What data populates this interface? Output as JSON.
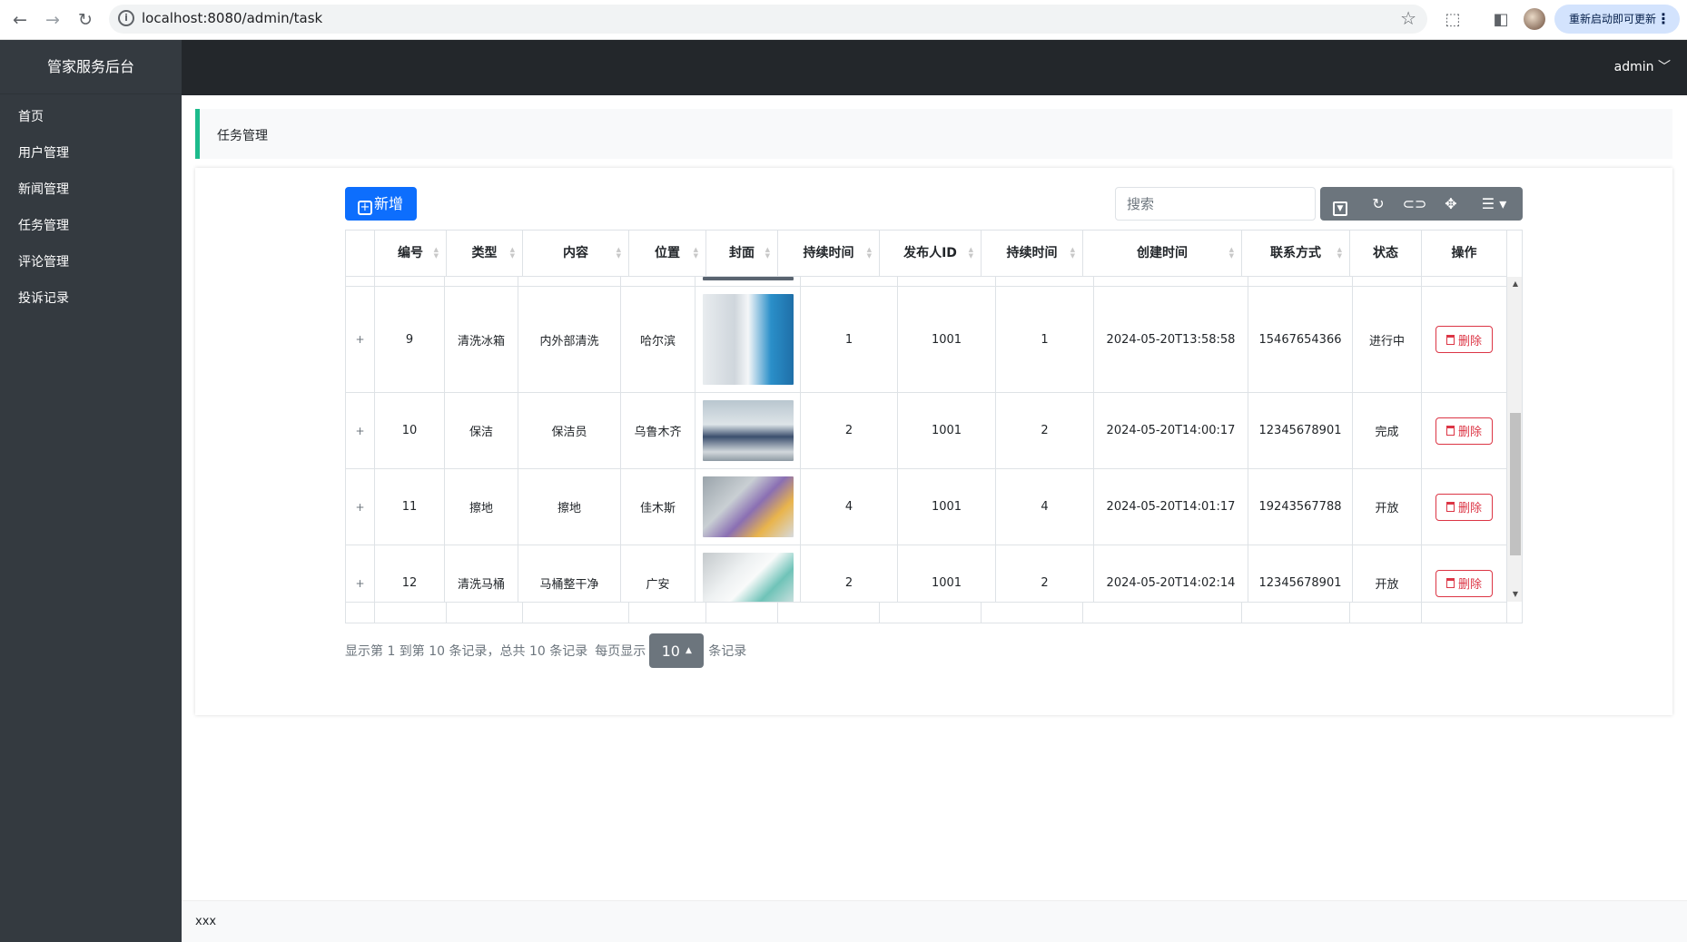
{
  "browser": {
    "url": "localhost:8080/admin/task",
    "update_label": "重新启动即可更新"
  },
  "sidebar": {
    "brand": "管家服务后台",
    "items": [
      {
        "label": "首页"
      },
      {
        "label": "用户管理"
      },
      {
        "label": "新闻管理"
      },
      {
        "label": "任务管理"
      },
      {
        "label": "评论管理"
      },
      {
        "label": "投诉记录"
      }
    ]
  },
  "header": {
    "user": "admin ﹀"
  },
  "breadcrumb": "任务管理",
  "toolbar": {
    "add_label": "新增",
    "search_placeholder": "搜索",
    "icons": [
      "paginationSwitch-icon",
      "refresh-icon",
      "toggle-icon",
      "fullscreen-icon",
      "columns-icon"
    ]
  },
  "table": {
    "headers": [
      "",
      "编号",
      "类型",
      "内容",
      "位置",
      "封面",
      "持续时间",
      "发布人ID",
      "持续时间",
      "创建时间",
      "联系方式",
      "状态",
      "操作"
    ],
    "rows": [
      {
        "id": "9",
        "type": "清洗冰箱",
        "content": "内外部清洗",
        "location": "哈尔滨",
        "cover": "fridge-cleaning-photo",
        "duration": "1",
        "publisher": "1001",
        "duration2": "1",
        "created": "2024-05-20T13:58:58",
        "contact": "15467654366",
        "status": "进行中",
        "action": "删除"
      },
      {
        "id": "10",
        "type": "保洁",
        "content": "保洁员",
        "location": "乌鲁木齐",
        "cover": "vacuum-cleaning-photo",
        "duration": "2",
        "publisher": "1001",
        "duration2": "2",
        "created": "2024-05-20T14:00:17",
        "contact": "12345678901",
        "status": "完成",
        "action": "删除"
      },
      {
        "id": "11",
        "type": "擦地",
        "content": "擦地",
        "location": "佳木斯",
        "cover": "floor-cleaning-photo",
        "duration": "4",
        "publisher": "1001",
        "duration2": "4",
        "created": "2024-05-20T14:01:17",
        "contact": "19243567788",
        "status": "开放",
        "action": "删除"
      },
      {
        "id": "12",
        "type": "清洗马桶",
        "content": "马桶整干净",
        "location": "广安",
        "cover": "toilet-cleaning-photo",
        "duration": "2",
        "publisher": "1001",
        "duration2": "2",
        "created": "2024-05-20T14:02:14",
        "contact": "12345678901",
        "status": "开放",
        "action": "删除"
      }
    ]
  },
  "pagination": {
    "summary": "显示第 1 到第 10 条记录，总共 10 条记录",
    "per_page_prefix": "每页显示",
    "page_size": "10",
    "per_page_suffix": "条记录"
  },
  "footer": "xxx",
  "colors": {
    "sidebar": "#343a40",
    "topbar": "#23272b",
    "accent": "#1cbb8c",
    "primary": "#0d6efd",
    "danger": "#dc3545",
    "secondary": "#6c757d"
  }
}
